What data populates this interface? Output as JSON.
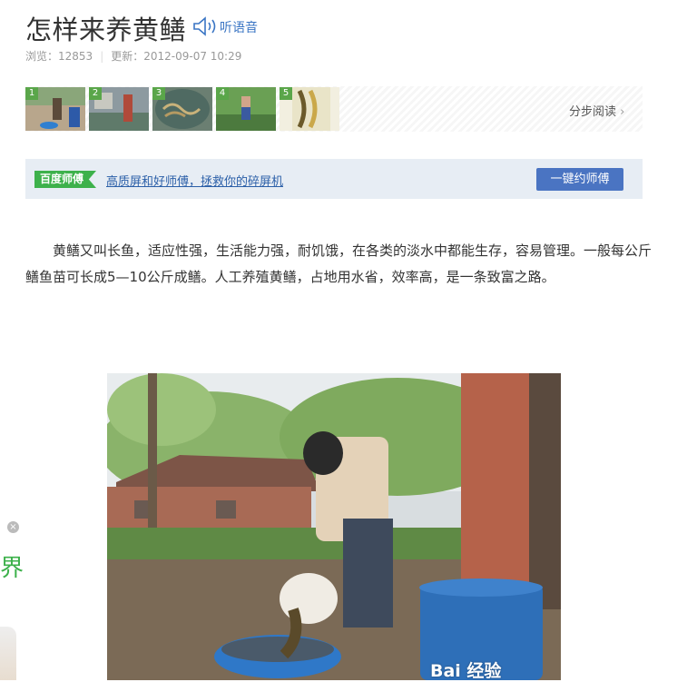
{
  "article": {
    "title": "怎样来养黄鳝",
    "listen_label": "听语音",
    "views_label": "浏览：12853",
    "updated_label": "更新：2012-09-07 10:29"
  },
  "steps": {
    "thumbnails": [
      "1",
      "2",
      "3",
      "4",
      "5"
    ],
    "step_read_label": "分步阅读"
  },
  "banner": {
    "tag": "百度师傅",
    "link": "高质屏和好师傅，拯救你的碎屏机",
    "button": "一键约师傅"
  },
  "body": {
    "paragraph": "黄鳝又叫长鱼，适应性强，生活能力强，耐饥饿，在各类的淡水中都能生存，容易管理。一般每公斤鳝鱼苗可长成5—10公斤成鳝。人工养殖黄鳝，占地用水省，效率高，是一条致富之路。"
  },
  "side": {
    "text": "界"
  },
  "photo": {
    "watermark": "Bai 经验"
  },
  "colors": {
    "accent_blue": "#4a74c2",
    "brand_green": "#3db14b",
    "link_blue": "#2b5fa8"
  }
}
